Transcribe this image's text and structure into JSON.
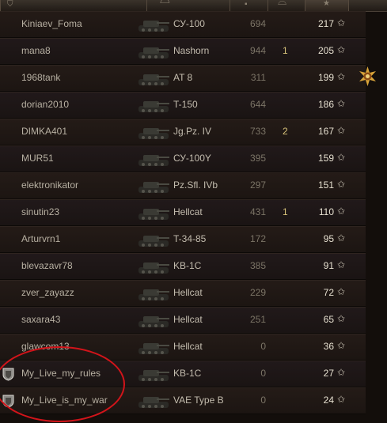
{
  "colors": {
    "row_bg": "#241b17",
    "text": "#b7b0a2",
    "kills": "#d6c27a",
    "highlight_circle": "#d2141a"
  },
  "header": {
    "icons": [
      "shield-icon",
      "tank-icon",
      "damage-icon",
      "kills-icon",
      "star-icon"
    ]
  },
  "rows": [
    {
      "player": "Kiniaev_Foma",
      "tank": "СУ-100",
      "damage": "694",
      "kills": "",
      "xp": "217",
      "badge": false,
      "icon": "tank-silhouette"
    },
    {
      "player": "mana8",
      "tank": "Nashorn",
      "damage": "944",
      "kills": "1",
      "xp": "205",
      "badge": false,
      "icon": "tank-silhouette"
    },
    {
      "player": "1968tank",
      "tank": "AT 8",
      "damage": "311",
      "kills": "",
      "xp": "199",
      "badge": false,
      "icon": "tank-silhouette"
    },
    {
      "player": "dorian2010",
      "tank": "T-150",
      "damage": "644",
      "kills": "",
      "xp": "186",
      "badge": false,
      "icon": "tank-silhouette"
    },
    {
      "player": "DIMKA401",
      "tank": "Jg.Pz. IV",
      "damage": "733",
      "kills": "2",
      "xp": "167",
      "badge": false,
      "icon": "tank-silhouette"
    },
    {
      "player": "MUR51",
      "tank": "СУ-100Y",
      "damage": "395",
      "kills": "",
      "xp": "159",
      "badge": false,
      "icon": "tank-silhouette"
    },
    {
      "player": "elektronikator",
      "tank": "Pz.Sfl. IVb",
      "damage": "297",
      "kills": "",
      "xp": "151",
      "badge": false,
      "icon": "tank-silhouette"
    },
    {
      "player": "sinutin23",
      "tank": "Hellcat",
      "damage": "431",
      "kills": "1",
      "xp": "110",
      "badge": false,
      "icon": "tank-silhouette"
    },
    {
      "player": "Arturvrn1",
      "tank": "T-34-85",
      "damage": "172",
      "kills": "",
      "xp": "95",
      "badge": false,
      "icon": "tank-silhouette"
    },
    {
      "player": "blevazavr78",
      "tank": "KB-1C",
      "damage": "385",
      "kills": "",
      "xp": "91",
      "badge": false,
      "icon": "tank-silhouette"
    },
    {
      "player": "zver_zayazz",
      "tank": "Hellcat",
      "damage": "229",
      "kills": "",
      "xp": "72",
      "badge": false,
      "icon": "tank-silhouette"
    },
    {
      "player": "saxara43",
      "tank": "Hellcat",
      "damage": "251",
      "kills": "",
      "xp": "65",
      "badge": false,
      "icon": "tank-silhouette"
    },
    {
      "player": "glawcom13",
      "tank": "Hellcat",
      "damage": "0",
      "kills": "",
      "xp": "36",
      "badge": false,
      "icon": "tank-silhouette"
    },
    {
      "player": "My_Live_my_rules",
      "tank": "KB-1C",
      "damage": "0",
      "kills": "",
      "xp": "27",
      "badge": true,
      "icon": "tank-silhouette"
    },
    {
      "player": "My_Live_is_my_war",
      "tank": "VAE Type B",
      "damage": "0",
      "kills": "",
      "xp": "24",
      "badge": true,
      "icon": "tank-silhouette"
    }
  ],
  "star_glyph": "✩",
  "medal_icon": "top-gun-medal-icon"
}
